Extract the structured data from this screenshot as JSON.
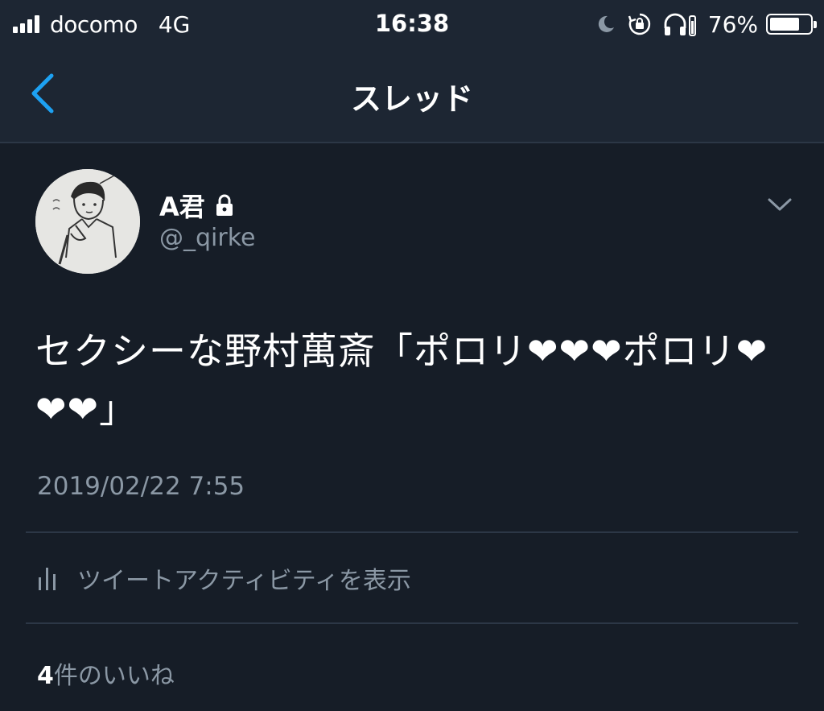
{
  "status_bar": {
    "carrier": "docomo",
    "network": "4G",
    "time": "16:38",
    "battery_percent": "76%",
    "battery_level": 0.76,
    "icons": [
      "signal-icon",
      "moon-icon",
      "rotation-lock-icon",
      "headphones-icon",
      "battery-icon"
    ]
  },
  "nav": {
    "title": "スレッド",
    "back_icon": "chevron-left-icon",
    "accent_color": "#1da1f2"
  },
  "tweet": {
    "display_name": "A君",
    "protected_icon": "lock-icon",
    "username": "@_qirke",
    "text": "セクシーな野村萬斎「ポロリ❤❤❤ポロリ❤❤❤」",
    "timestamp": "2019/02/22 7:55",
    "activity_label": "ツイートアクティビティを表示",
    "likes_count": "4",
    "likes_label": "件のいいね"
  },
  "colors": {
    "background": "#161d27",
    "bar_background": "#1d2633",
    "secondary_text": "#8b98a5",
    "divider": "#2c3746"
  }
}
